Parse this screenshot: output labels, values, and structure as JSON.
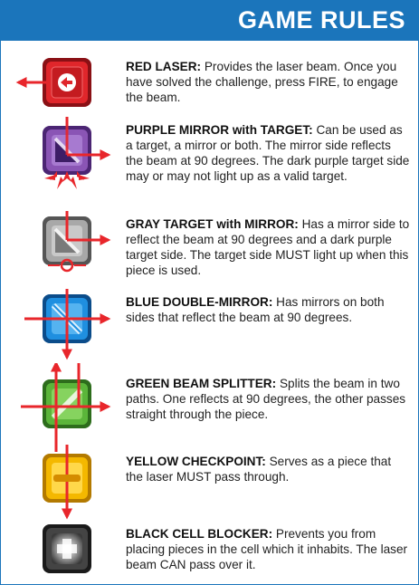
{
  "header": {
    "title": "GAME RULES"
  },
  "rules": [
    {
      "title": "RED LASER:",
      "description": "Provides the laser beam. Once you have solved the challenge, press FIRE, to engage the beam.",
      "color": "#e0262b",
      "icon": "red-laser-icon"
    },
    {
      "title": "PURPLE MIRROR with TARGET:",
      "description": "Can be used as a target, a mirror or both. The mirror side reflects the beam at 90 degrees. The dark purple target side may or may not light up as a valid target.",
      "color": "#8a55b5",
      "icon": "purple-mirror-target-icon"
    },
    {
      "title": "GRAY TARGET with MIRROR:",
      "description": "Has a mirror side to reflect the beam at 90 degrees and a dark purple target side. The target side MUST light up when this piece is used.",
      "color": "#9a9a9a",
      "icon": "gray-target-mirror-icon"
    },
    {
      "title": "BLUE DOUBLE-MIRROR:",
      "description": "Has mirrors on both sides that reflect the beam at 90 degrees.",
      "color": "#1f8fe0",
      "icon": "blue-double-mirror-icon"
    },
    {
      "title": "GREEN BEAM SPLITTER:",
      "description": "Splits the beam in two paths. One reflects at 90 degrees, the other passes straight through the piece.",
      "color": "#5bb53a",
      "icon": "green-beam-splitter-icon"
    },
    {
      "title": "YELLOW CHECKPOINT:",
      "description": "Serves as a piece that the laser MUST pass through.",
      "color": "#f4b800",
      "icon": "yellow-checkpoint-icon"
    },
    {
      "title": "BLACK CELL BLOCKER:",
      "description": "Prevents you from placing pieces in the cell which it inhabits. The laser beam CAN pass over it.",
      "color": "#333333",
      "icon": "black-cell-blocker-icon"
    }
  ]
}
